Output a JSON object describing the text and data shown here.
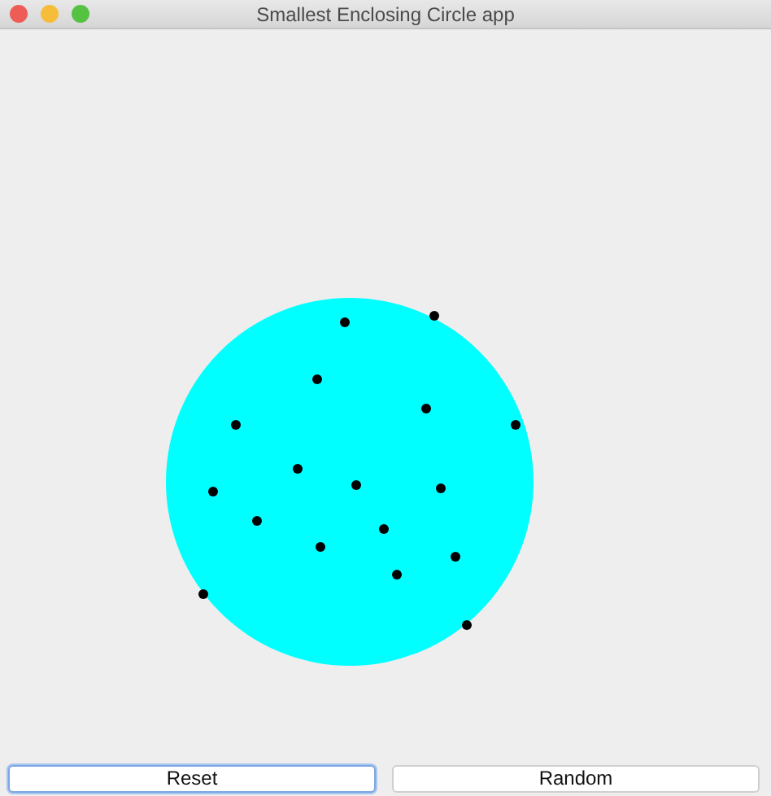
{
  "window": {
    "title": "Smallest Enclosing Circle app"
  },
  "buttons": [
    {
      "label": "Reset",
      "focused": true
    },
    {
      "label": "Random",
      "focused": false
    }
  ]
}
